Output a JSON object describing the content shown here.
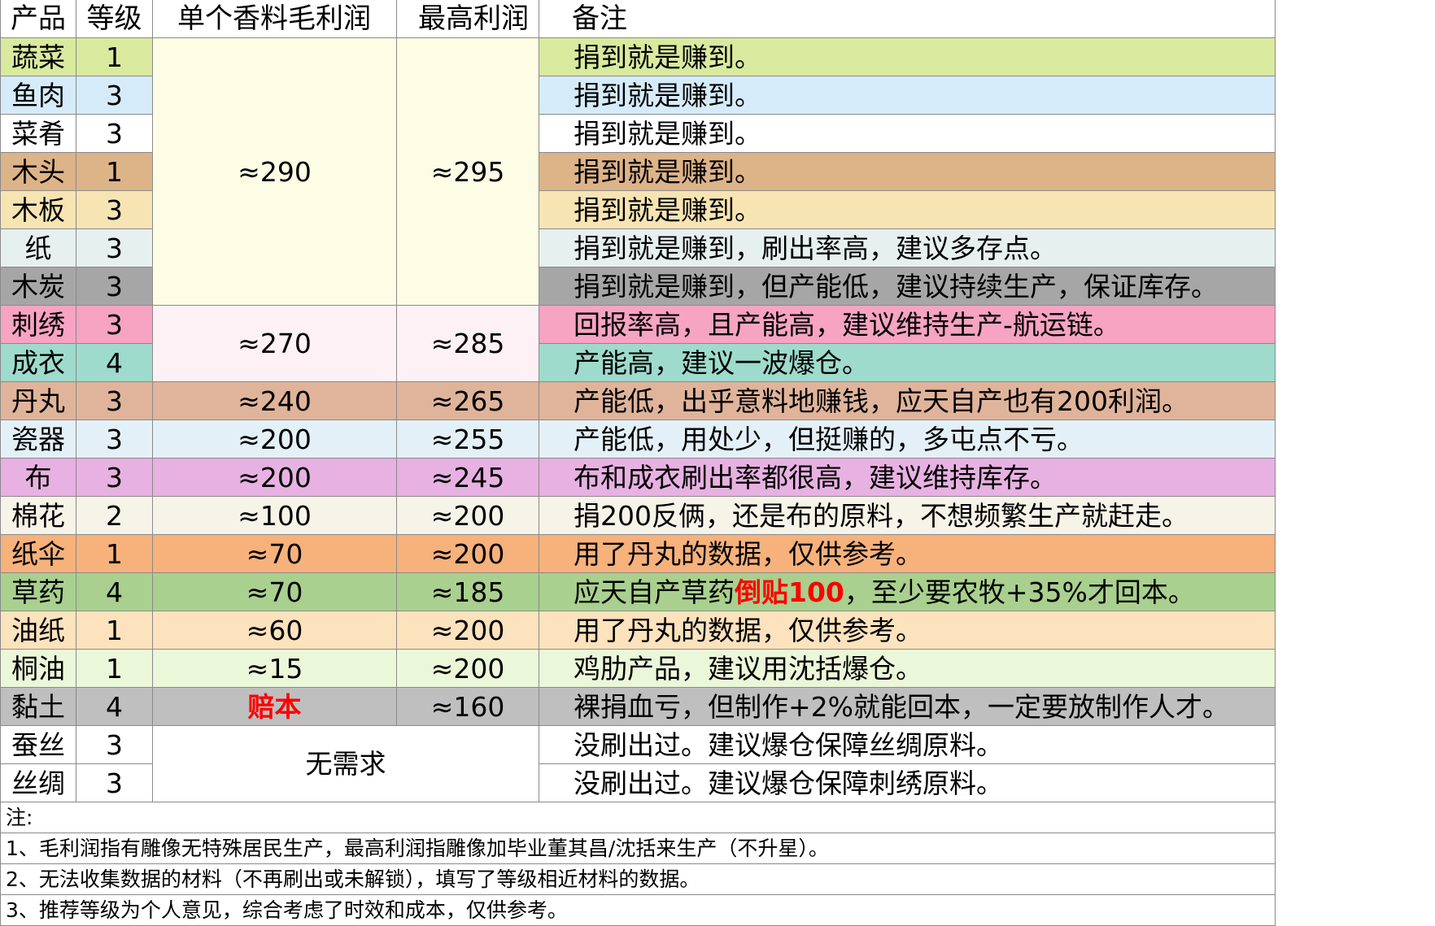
{
  "headers": {
    "product": "产品",
    "level": "等级",
    "profit": "单个香料毛利润",
    "max_profit": "最高利润",
    "remark": "备注"
  },
  "rows": [
    {
      "product": "蔬菜",
      "level": "1",
      "remark": "捐到就是赚到。",
      "color": "#d9ea9f"
    },
    {
      "product": "鱼肉",
      "level": "3",
      "remark": "捐到就是赚到。",
      "color": "#d6ebf9"
    },
    {
      "product": "菜肴",
      "level": "3",
      "remark": "捐到就是赚到。",
      "color": "#ffffff"
    },
    {
      "product": "木头",
      "level": "1",
      "remark": "捐到就是赚到。",
      "color": "#ddb388"
    },
    {
      "product": "木板",
      "level": "3",
      "remark": "捐到就是赚到。",
      "color": "#f7e4b3"
    },
    {
      "product": "纸",
      "level": "3",
      "remark": "捐到就是赚到，刷出率高，建议多存点。",
      "color": "#e6f0ef"
    },
    {
      "product": "木炭",
      "level": "3",
      "remark": "捐到就是赚到，但产能低，建议持续生产，保证库存。",
      "color": "#a6a6a6"
    },
    {
      "product": "刺绣",
      "level": "3",
      "remark": "回报率高，且产能高，建议维持生产-航运链。",
      "color": "#f7a3c2"
    },
    {
      "product": "成衣",
      "level": "4",
      "remark": "产能高，建议一波爆仓。",
      "color": "#9edbcc"
    },
    {
      "product": "丹丸",
      "level": "3",
      "profit": "≈240",
      "max_profit": "≈265",
      "remark": "产能低，出乎意料地赚钱，应天自产也有200利润。",
      "color": "#dfb49a"
    },
    {
      "product": "瓷器",
      "level": "3",
      "profit": "≈200",
      "max_profit": "≈255",
      "remark": "产能低，用处少，但挺赚的，多屯点不亏。",
      "color": "#e4f0f7"
    },
    {
      "product": "布",
      "level": "3",
      "profit": "≈200",
      "max_profit": "≈245",
      "remark": "布和成衣刷出率都很高，建议维持库存。",
      "color": "#e7b1e2"
    },
    {
      "product": "棉花",
      "level": "2",
      "profit": "≈100",
      "max_profit": "≈200",
      "remark": "捐200反俩，还是布的原料，不想频繁生产就赶走。",
      "color": "#f6f3e8"
    },
    {
      "product": "纸伞",
      "level": "1",
      "profit": "≈70",
      "max_profit": "≈200",
      "remark": "用了丹丸的数据，仅供参考。",
      "color": "#f7b17b"
    },
    {
      "product": "草药",
      "level": "4",
      "profit": "≈70",
      "max_profit": "≈185",
      "remark_a": "应天自产草药",
      "remark_red": "倒贴100",
      "remark_b": "，至少要农牧+35%才回本。",
      "color": "#a9d08e"
    },
    {
      "product": "油纸",
      "level": "1",
      "profit": "≈60",
      "max_profit": "≈200",
      "remark": "用了丹丸的数据，仅供参考。",
      "color": "#fce2bd"
    },
    {
      "product": "桐油",
      "level": "1",
      "profit": "≈15",
      "max_profit": "≈200",
      "remark": "鸡肋产品，建议用沈括爆仓。",
      "color": "#ebf7d9"
    },
    {
      "product": "黏土",
      "level": "4",
      "profit": "赔本",
      "max_profit": "≈160",
      "remark": "裸捐血亏，但制作+2%就能回本，一定要放制作人才。",
      "color": "#bfbfbf"
    },
    {
      "product": "蚕丝",
      "level": "3",
      "remark": "没刷出过。建议爆仓保障丝绸原料。",
      "color": "#ffffff"
    },
    {
      "product": "丝绸",
      "level": "3",
      "remark": "没刷出过。建议爆仓保障刺绣原料。",
      "color": "#ffffff"
    }
  ],
  "groups": {
    "g1": {
      "profit": "≈290",
      "max_profit": "≈295"
    },
    "g2": {
      "profit": "≈270",
      "max_profit": "≈285"
    },
    "g3": {
      "label": "无需求"
    }
  },
  "notes": [
    "注:",
    "1、毛利润指有雕像无特殊居民生产，最高利润指雕像加毕业董其昌/沈括来生产（不升星）。",
    "2、无法收集数据的材料（不再刷出或未解锁），填写了等级相近材料的数据。",
    "3、推荐等级为个人意见，综合考虑了时效和成本，仅供参考。"
  ]
}
